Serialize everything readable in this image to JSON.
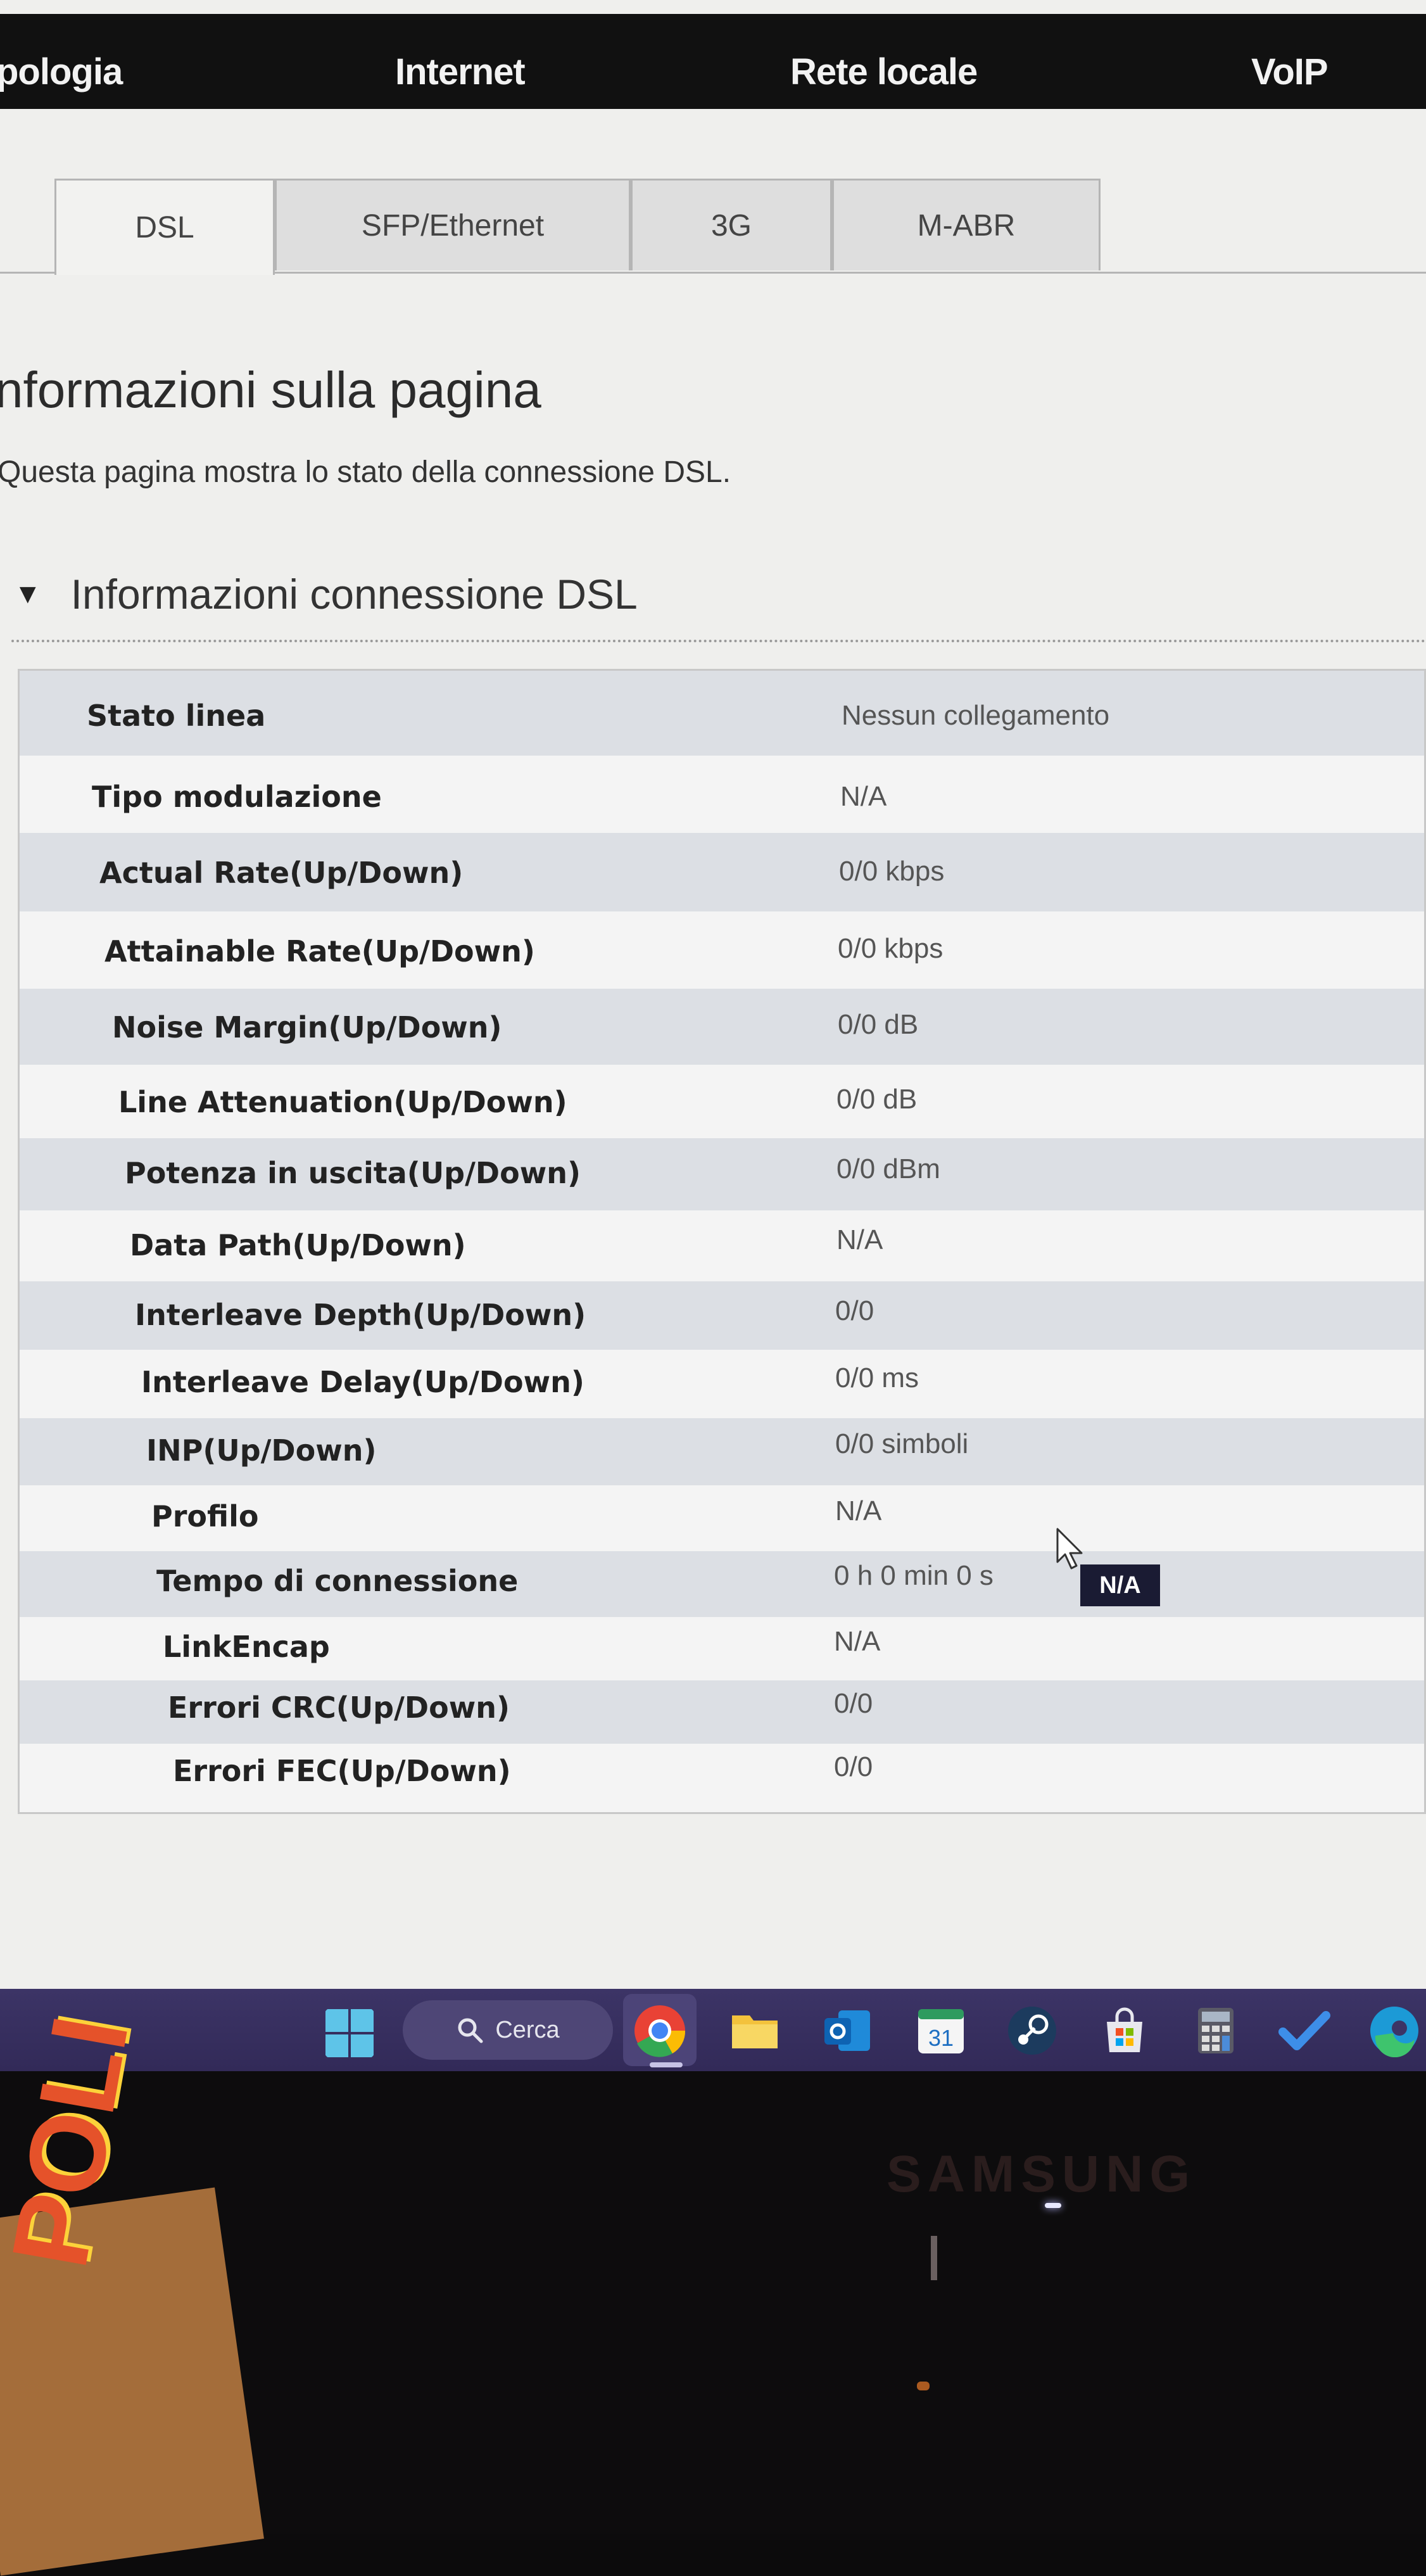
{
  "topnav": {
    "items": [
      "pologia",
      "Internet",
      "Rete locale",
      "VoIP"
    ]
  },
  "tabs": [
    "DSL",
    "SFP/Ethernet",
    "3G",
    "M-ABR"
  ],
  "active_tab": "DSL",
  "page": {
    "title": "nformazioni sulla pagina",
    "description": "Questa pagina mostra lo stato della connessione DSL."
  },
  "section": {
    "arrow": "▼",
    "title": "Informazioni connessione DSL"
  },
  "rows": [
    {
      "label": "Stato linea",
      "value": "Nessun collegamento"
    },
    {
      "label": "Tipo modulazione",
      "value": "N/A"
    },
    {
      "label": "Actual Rate(Up/Down)",
      "value": "0/0 kbps"
    },
    {
      "label": "Attainable Rate(Up/Down)",
      "value": "0/0 kbps"
    },
    {
      "label": "Noise Margin(Up/Down)",
      "value": "0/0 dB"
    },
    {
      "label": "Line Attenuation(Up/Down)",
      "value": "0/0 dB"
    },
    {
      "label": "Potenza in uscita(Up/Down)",
      "value": "0/0 dBm"
    },
    {
      "label": "Data Path(Up/Down)",
      "value": "N/A"
    },
    {
      "label": "Interleave Depth(Up/Down)",
      "value": "0/0"
    },
    {
      "label": "Interleave Delay(Up/Down)",
      "value": "0/0 ms"
    },
    {
      "label": "INP(Up/Down)",
      "value": "0/0 simboli"
    },
    {
      "label": "Profilo",
      "value": "N/A"
    },
    {
      "label": "Tempo di connessione",
      "value": "0 h 0 min 0 s"
    },
    {
      "label": "LinkEncap",
      "value": "N/A"
    },
    {
      "label": "Errori CRC(Up/Down)",
      "value": "0/0"
    },
    {
      "label": "Errori FEC(Up/Down)",
      "value": "0/0"
    }
  ],
  "tooltip": "N/A",
  "taskbar": {
    "search_label": "Cerca",
    "calendar_day": "31",
    "icons": [
      "windows-start-icon",
      "search-icon",
      "chrome-icon",
      "file-explorer-icon",
      "outlook-icon",
      "calendar-icon",
      "steam-icon",
      "store-icon",
      "calculator-icon",
      "todo-icon",
      "edge-icon"
    ]
  },
  "monitor": {
    "brand": "SAMSUNG",
    "box_text": "POLI"
  },
  "colors": {
    "nav_bg": "#111111",
    "row_shade": "#dcdfe4",
    "tooltip_bg": "#1a1b33",
    "taskbar_bg": "#3c3466"
  }
}
